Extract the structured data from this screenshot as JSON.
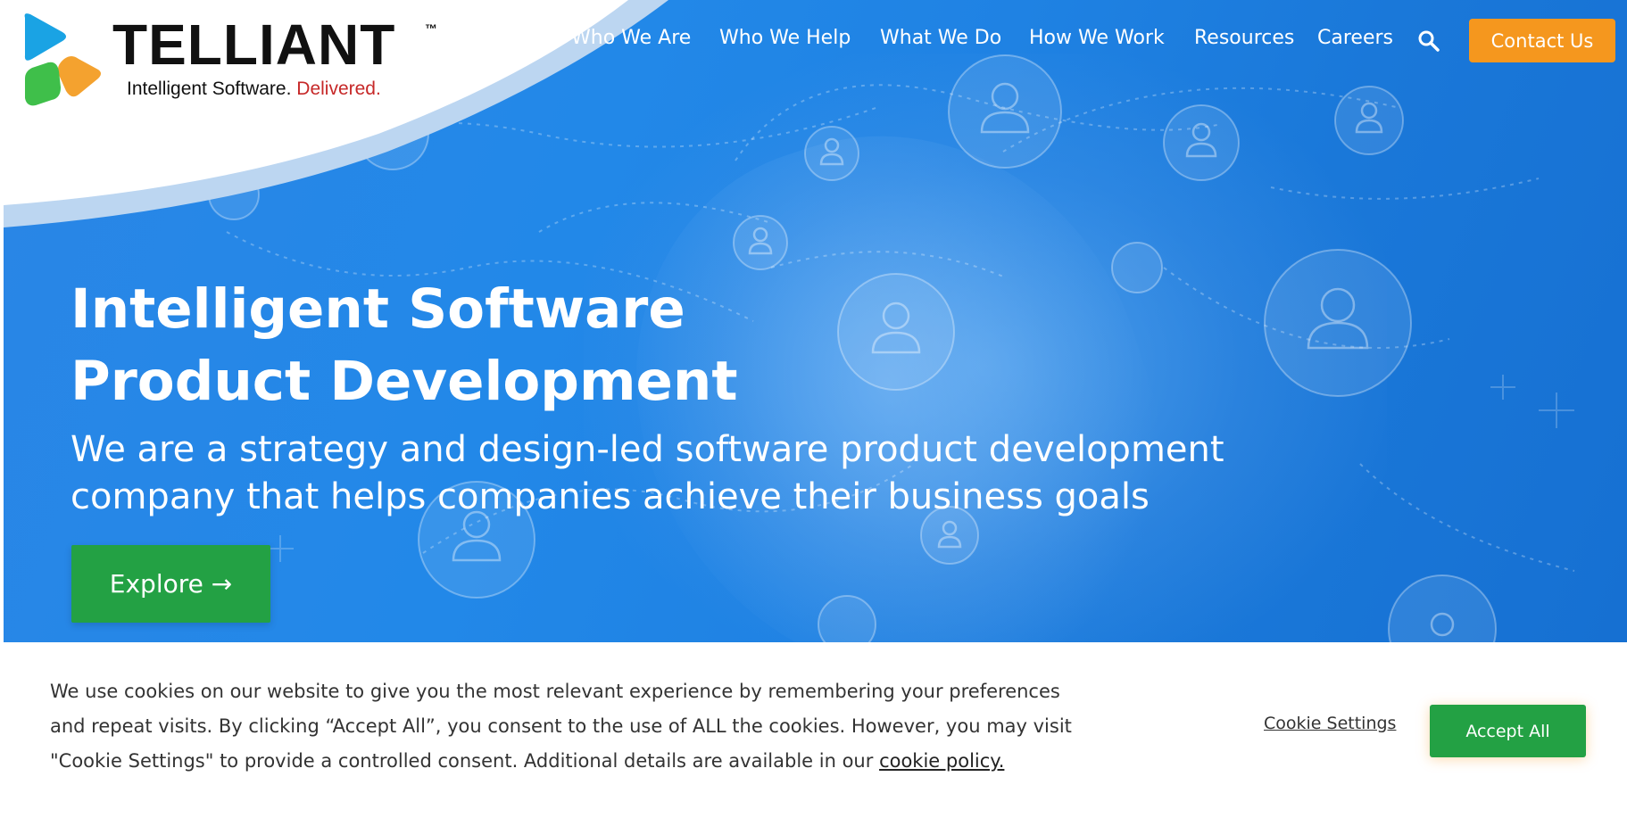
{
  "brand": {
    "name": "TELLIANT",
    "trademark": "™",
    "tagline_main": "Intelligent Software.",
    "tagline_accent": "Delivered."
  },
  "nav": {
    "items": [
      {
        "label": "Who We Are"
      },
      {
        "label": "Who We Help"
      },
      {
        "label": "What We Do"
      },
      {
        "label": "How We Work"
      },
      {
        "label": "Resources"
      },
      {
        "label": "Careers"
      }
    ],
    "search_icon": "search-icon",
    "contact_label": "Contact Us"
  },
  "hero": {
    "title_line1": "Intelligent Software",
    "title_line2": "Product Development",
    "subtitle_line1": "We are a strategy and design-led software product development",
    "subtitle_line2": "company that helps companies achieve their business goals",
    "explore_label": "Explore →"
  },
  "cookie": {
    "text_line1": "We use cookies on our website to give you the most relevant experience by remembering your preferences",
    "text_line2": "and repeat visits. By clicking “Accept All”, you consent to the use of ALL the cookies. However, you may visit",
    "text_line3_prefix": "\"Cookie Settings\" to provide a controlled consent. Additional details are available in our",
    "policy_link": "cookie policy.",
    "settings_label": "Cookie Settings",
    "accept_label": "Accept All"
  },
  "colors": {
    "hero_blue": "#2288e8",
    "accent_orange": "#f5971e",
    "accent_green": "#23a144",
    "tagline_red": "#c62828"
  }
}
